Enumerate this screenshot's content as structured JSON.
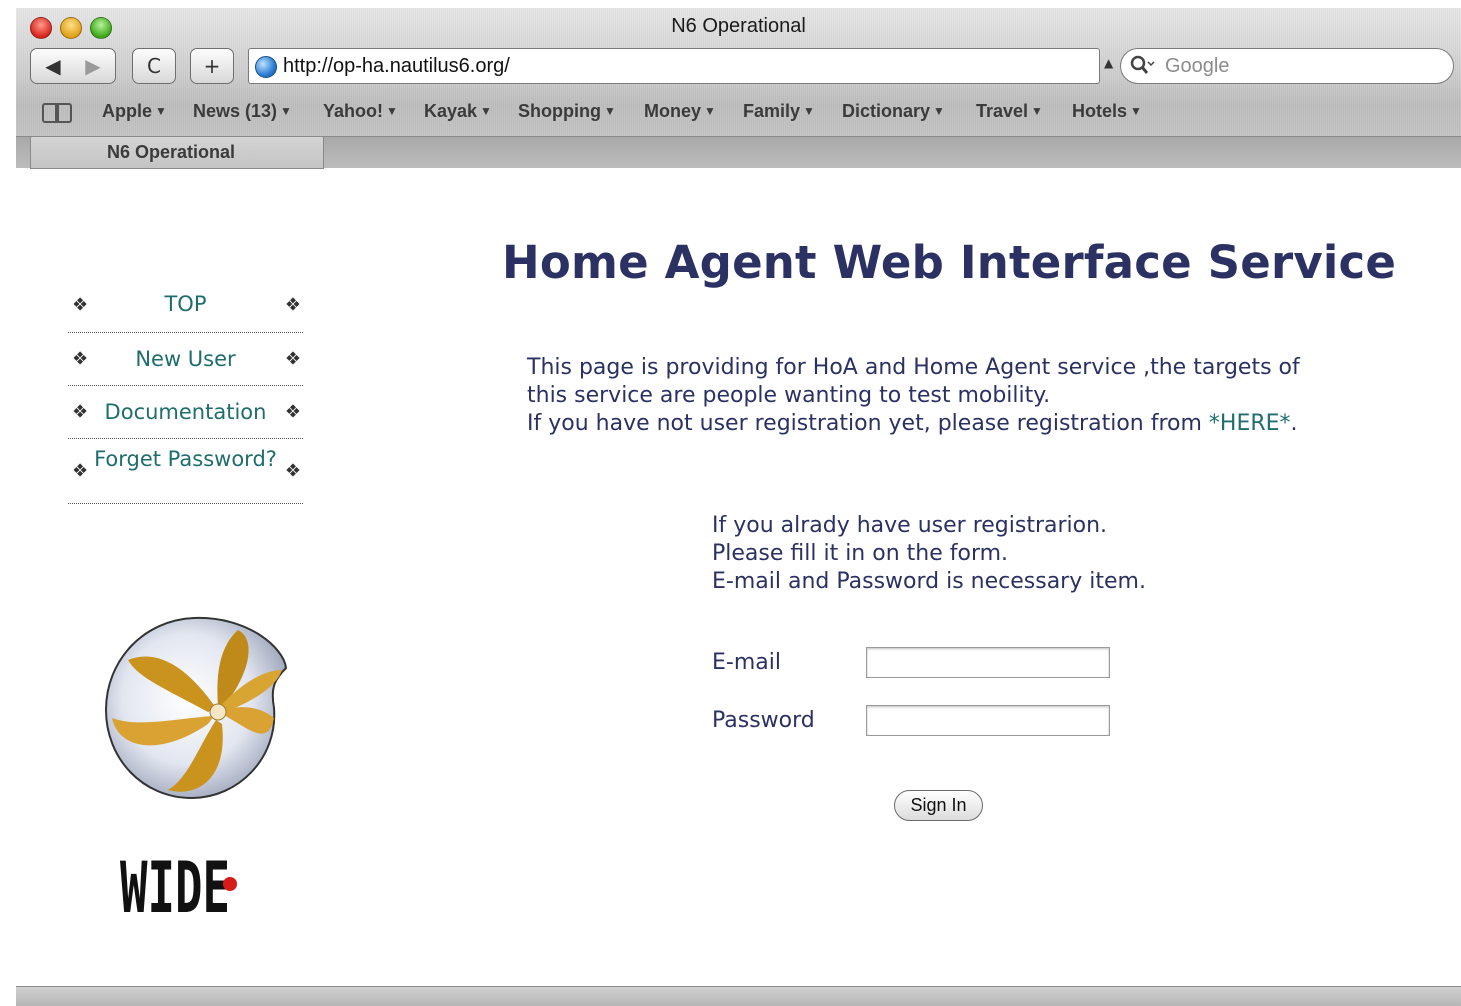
{
  "window": {
    "title": "N6 Operational"
  },
  "toolbar": {
    "back_symbol": "◀",
    "forward_symbol": "▶",
    "reload_symbol": "C",
    "add_symbol": "+",
    "url": "http://op-ha.nautilus6.org/",
    "search_placeholder": "Google"
  },
  "bookmarks": {
    "items": [
      {
        "label": "Apple"
      },
      {
        "label": "News (13)"
      },
      {
        "label": "Yahoo!"
      },
      {
        "label": "Kayak"
      },
      {
        "label": "Shopping"
      },
      {
        "label": "Money"
      },
      {
        "label": "Family"
      },
      {
        "label": "Dictionary"
      },
      {
        "label": "Travel"
      },
      {
        "label": "Hotels"
      }
    ],
    "arrow": "▼"
  },
  "tabs": [
    {
      "label": "N6 Operational"
    }
  ],
  "sidebar": {
    "bullet": "❖",
    "items": [
      {
        "label": "TOP"
      },
      {
        "label": "New User"
      },
      {
        "label": "Documentation"
      },
      {
        "label": "Forget Password?"
      }
    ],
    "logo_text": "WIDE"
  },
  "main": {
    "heading": "Home Agent Web Interface Service",
    "intro": {
      "line1": "This page is providing for HoA and Home Agent service ,the targets of",
      "line2": "this service are people wanting to test mobility.",
      "line3": "If you have not user registration yet, please registration from ",
      "here_link": "*HERE*",
      "line3_end": "."
    },
    "instructions": {
      "line1": "If you alrady have user registrarion.",
      "line2": "Please fill it in on the form.",
      "line3": "E-mail and Password is necessary item."
    },
    "form": {
      "email_label": "E-mail",
      "email_value": "",
      "password_label": "Password",
      "password_value": "",
      "submit_label": "Sign In"
    }
  },
  "colors": {
    "heading": "#2b3163",
    "link": "#1f6d6d",
    "text": "#2b3163"
  }
}
